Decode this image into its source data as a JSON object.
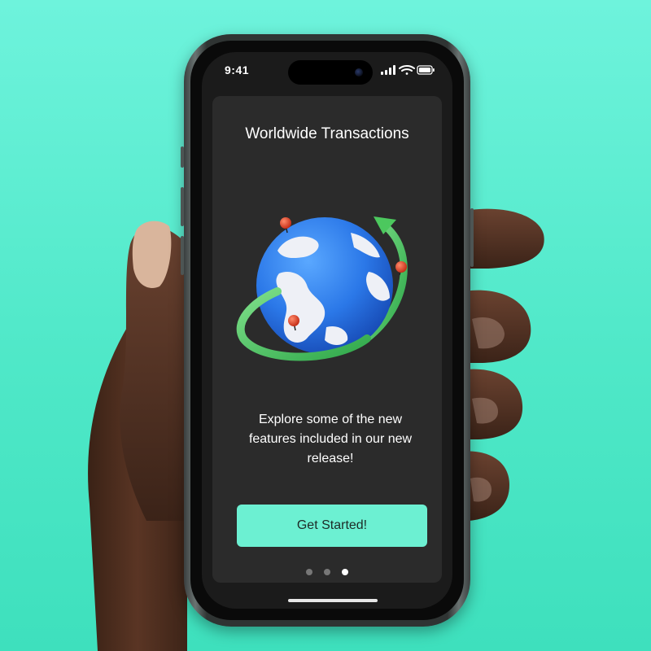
{
  "status_bar": {
    "time": "9:41"
  },
  "onboarding": {
    "title": "Worldwide Transactions",
    "description": "Explore some of the new features included in our new release!",
    "cta_label": "Get Started!",
    "page_indicator": {
      "total": 3,
      "active_index": 2
    },
    "illustration": "globe-with-orbit-arrow-icon"
  },
  "colors": {
    "background": "#4fe8c8",
    "screen": "#1b1b1b",
    "card": "#2b2b2b",
    "accent": "#6cf0d2",
    "text": "#ffffff"
  }
}
